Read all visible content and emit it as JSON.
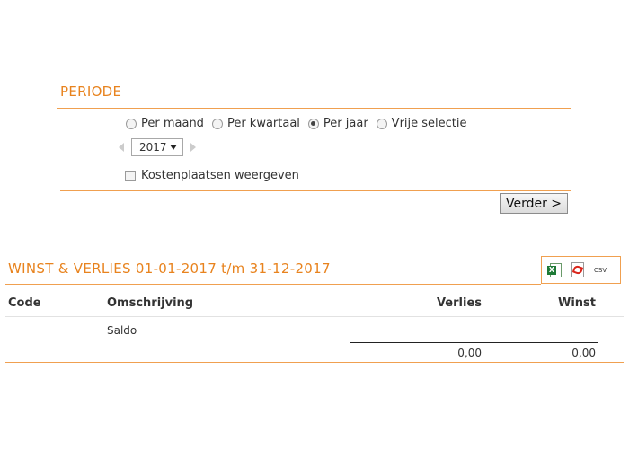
{
  "periode": {
    "title": "PERIODE",
    "options": [
      "Per maand",
      "Per kwartaal",
      "Per jaar",
      "Vrije selectie"
    ],
    "selected": "Per jaar",
    "year": "2017",
    "checkbox_label": "Kostenplaatsen weergeven",
    "checkbox_checked": false,
    "next_button": "Verder >"
  },
  "report": {
    "title": "WINST & VERLIES 01-01-2017 t/m 31-12-2017",
    "export": {
      "excel_icon": "excel-icon",
      "pdf_icon": "pdf-icon",
      "csv_label": "CSV"
    },
    "columns": {
      "code": "Code",
      "omschrijving": "Omschrijving",
      "verlies": "Verlies",
      "winst": "Winst"
    },
    "rows": [
      {
        "code": "",
        "omschrijving": "Saldo"
      }
    ],
    "totals": {
      "verlies": "0,00",
      "winst": "0,00"
    }
  },
  "colors": {
    "accent": "#e8831e",
    "line": "#f0a050"
  }
}
